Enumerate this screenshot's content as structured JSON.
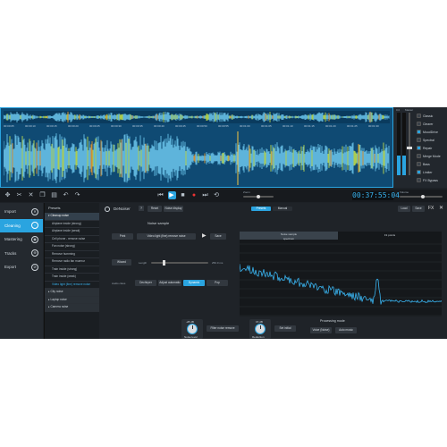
{
  "waveform_panel": {
    "timeline_ticks": [
      "00:00:05",
      "00:00:10",
      "00:00:15",
      "00:00:20",
      "00:00:25",
      "00:00:30",
      "00:00:35",
      "00:00:40",
      "00:00:45",
      "00:00:50",
      "00:00:55",
      "00:01:00",
      "00:01:05",
      "00:01:10",
      "00:01:15",
      "00:01:20",
      "00:01:25",
      "00:01:30"
    ],
    "colors": {
      "background": "#0f4a73",
      "wave_primary": "#6cc7ee",
      "wave_accent": "#c7e34a",
      "wave_hot": "#f09a2a",
      "border": "#2aa4e0"
    }
  },
  "side_panel": {
    "meter_labels": [
      "0.0",
      "Master"
    ],
    "items": [
      {
        "label": "Classic",
        "icon": "classic-icon",
        "active": false
      },
      {
        "label": "Clearer",
        "icon": "clearer-icon",
        "active": false
      },
      {
        "label": "MoodDrive",
        "icon": "mood-icon",
        "active": true
      },
      {
        "label": "Spectral",
        "icon": "spectral-icon",
        "active": false
      },
      {
        "label": "Repair",
        "icon": "repair-icon",
        "active": true
      },
      {
        "label": "Merge Mode",
        "icon": "merge-icon",
        "active": false
      },
      {
        "label": "Bass",
        "icon": "bass-icon",
        "active": false
      },
      {
        "label": "Limiter",
        "icon": "limiter-icon",
        "active": true
      },
      {
        "label": "FX Bypass",
        "icon": "bypass-icon",
        "active": false
      }
    ]
  },
  "toolbar": {
    "left_tools": [
      "cursor-icon",
      "cut-icon",
      "delete-icon",
      "copy-icon",
      "paste-icon",
      "undo-icon",
      "redo-icon"
    ],
    "transport": [
      "rewind-icon",
      "play-icon",
      "stop-icon",
      "record-icon",
      "forward-icon",
      "loop-icon"
    ],
    "zoom_label": "Zoom",
    "time": "00:37:55:04",
    "volume_label": "Volume"
  },
  "nav": {
    "items": [
      {
        "label": "Import",
        "icon": "import-icon",
        "active": false
      },
      {
        "label": "Cleaning",
        "icon": "cleaning-icon",
        "active": true
      },
      {
        "label": "Mastering",
        "icon": "mastering-icon",
        "active": false
      },
      {
        "label": "Tracks",
        "icon": "tracks-icon",
        "active": false
      },
      {
        "label": "Export",
        "icon": "export-icon",
        "active": false
      }
    ]
  },
  "presets": {
    "title": "Presets",
    "items": [
      {
        "label": "▾ Cleanup noise",
        "type": "cat-open"
      },
      {
        "label": "Airplane inside (strong)",
        "type": "item"
      },
      {
        "label": "Airplane inside (weak)",
        "type": "item"
      },
      {
        "label": "Cell phone - remove noise",
        "type": "item"
      },
      {
        "label": "Fan noise (strong)",
        "type": "item"
      },
      {
        "label": "Remove humming",
        "type": "item"
      },
      {
        "label": "Remove radio fan murmur",
        "type": "item"
      },
      {
        "label": "Train inside (strong)",
        "type": "item"
      },
      {
        "label": "Train inside (weak)",
        "type": "item"
      },
      {
        "label": "Video light (fine) remove noise",
        "type": "sel"
      },
      {
        "label": "▸ City noise",
        "type": "cat"
      },
      {
        "label": "▸ Laptop noise",
        "type": "cat"
      },
      {
        "label": "▸ Camera noise",
        "type": "cat"
      }
    ]
  },
  "module": {
    "title": "DeNoiser",
    "header_buttons": [
      "Reset",
      "Noise display"
    ],
    "right_tabs": [
      "Presets",
      "Manual"
    ],
    "right_buttons": [
      "Load",
      "Save"
    ],
    "noise_sample_title": "Noise sample",
    "print_label": "Print",
    "sample_value": "Video light (fine) remove noise",
    "save_label": "Save",
    "wizard_label": "Wizard",
    "length_label": "Length",
    "length_value": "250.0 ms",
    "mode_label": "Audio class",
    "mode_buttons": [
      "Dechirper",
      "Adjust automatic",
      "Dynamic",
      "Pop"
    ],
    "graph_tabs": [
      "Noise sample\nspectrum",
      "Fit points"
    ],
    "noise_level_label": "Noise level",
    "noise_level_value": "-28 dB",
    "reduction_label": "Reduction",
    "reduction_value": "15 dB",
    "noise_btn": "Filter noise remove",
    "reduction_btn": "Set initial",
    "processing_title": "Processing mode",
    "processing_buttons": [
      "Voice (Noise)",
      "Auto music"
    ],
    "close_icon": "close-icon"
  }
}
